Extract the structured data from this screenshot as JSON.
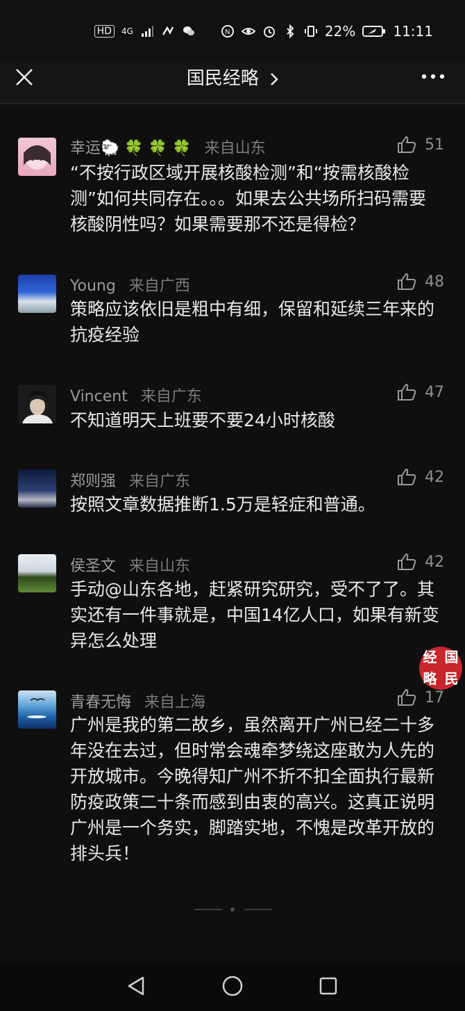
{
  "status_bar": {
    "hd": "HD",
    "network": "4G",
    "battery": "22%",
    "time": "11:11"
  },
  "header": {
    "title": "国民经略"
  },
  "comments": [
    {
      "name": "幸运",
      "emoji": "🐑 🍀 🍀 🍀",
      "location": "来自山东",
      "likes": "51",
      "text": "“不按行政区域开展核酸检测”和“按需核酸检测”如何共同存在。。。如果去公共场所扫码需要核酸阴性吗？如果需要那不还是得检？"
    },
    {
      "name": "Young",
      "location": "来自广西",
      "likes": "48",
      "text": "策略应该依旧是粗中有细，保留和延续三年来的抗疫经验"
    },
    {
      "name": "Vincent",
      "location": "来自广东",
      "likes": "47",
      "text": "不知道明天上班要不要24小时核酸"
    },
    {
      "name": "郑则强",
      "location": "来自广东",
      "likes": "42",
      "text": "按照文章数据推断1.5万是轻症和普通。"
    },
    {
      "name": "侯圣文",
      "location": "来自山东",
      "likes": "42",
      "text": "手动@山东各地，赶紧研究研究，受不了了。其实还有一件事就是，中国14亿人口，如果有新变异怎么处理"
    },
    {
      "name": "青春无悔",
      "location": "来自上海",
      "likes": "17",
      "text": "广州是我的第二故乡，虽然离开广州已经二十多年没在去过，但时常会魂牵梦绕这座敢为人先的开放城市。今晚得知广州不折不扣全面执行最新防疫政策二十条而感到由衷的高兴。这真正说明广州是一个务实，脚踏实地，不愧是改革开放的排头兵！"
    }
  ],
  "seal": [
    "经",
    "国",
    "略",
    "民"
  ]
}
